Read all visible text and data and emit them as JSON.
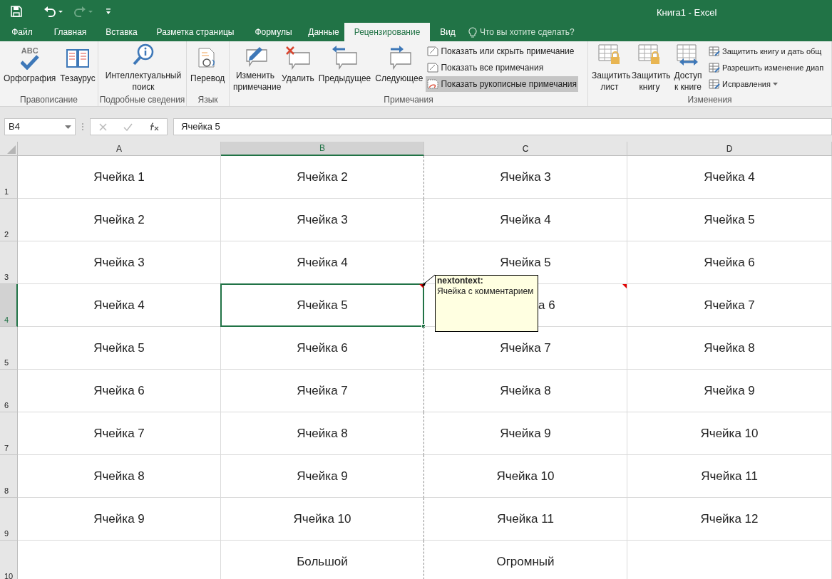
{
  "window": {
    "title": "Книга1 - Excel"
  },
  "tabs": [
    {
      "label": "Файл",
      "selected": false
    },
    {
      "label": "Главная",
      "selected": false
    },
    {
      "label": "Вставка",
      "selected": false
    },
    {
      "label": "Разметка страницы",
      "selected": false
    },
    {
      "label": "Формулы",
      "selected": false
    },
    {
      "label": "Данные",
      "selected": false
    },
    {
      "label": "Рецензирование",
      "selected": true
    },
    {
      "label": "Вид",
      "selected": false
    }
  ],
  "tell_me": {
    "placeholder": "Что вы хотите сделать?"
  },
  "ribbon_groups": [
    {
      "label": "Правописание",
      "items": [
        {
          "kind": "big",
          "label": "Орфография",
          "icon_text": "ABC",
          "on": false
        },
        {
          "kind": "big",
          "label": "Тезаурус",
          "on": false
        }
      ]
    },
    {
      "label": "Подробные сведения",
      "items": [
        {
          "kind": "big",
          "label": "Интеллектуальный поиск",
          "on": false
        }
      ]
    },
    {
      "label": "Язык",
      "items": [
        {
          "kind": "big",
          "label": "Перевод",
          "on": false
        }
      ]
    },
    {
      "label": "Примечания",
      "items": [
        {
          "kind": "big",
          "label": "Изменить примечание",
          "on": false
        },
        {
          "kind": "big",
          "label": "Удалить",
          "on": false
        },
        {
          "kind": "big",
          "label": "Предыдущее",
          "on": false
        },
        {
          "kind": "big",
          "label": "Следующее",
          "on": false
        },
        {
          "kind": "small",
          "label": "Показать или скрыть примечание",
          "on": false
        },
        {
          "kind": "small",
          "label": "Показать все примечания",
          "on": false
        },
        {
          "kind": "small",
          "label": "Показать рукописные примечания",
          "on": true
        }
      ]
    },
    {
      "label": "Изменения",
      "items": [
        {
          "kind": "big",
          "label": "Защитить лист",
          "on": false
        },
        {
          "kind": "big",
          "label": "Защитить книгу",
          "on": false
        },
        {
          "kind": "big",
          "label": "Доступ к книге",
          "on": false
        },
        {
          "kind": "small",
          "label": "Защитить книгу и дать общ",
          "on": false
        },
        {
          "kind": "small",
          "label": "Разрешить изменение диап",
          "on": false
        },
        {
          "kind": "menu",
          "label": "Исправления",
          "on": false
        }
      ]
    }
  ],
  "formula_bar": {
    "name_box": "B4",
    "value": "Ячейка 5"
  },
  "columns": [
    {
      "label": "A",
      "selected": false
    },
    {
      "label": "B",
      "selected": true
    },
    {
      "label": "C",
      "selected": false
    },
    {
      "label": "D",
      "selected": false
    }
  ],
  "rows": [
    {
      "header": "1",
      "selected": false,
      "cells": [
        {
          "text": "Ячейка 1",
          "selected": false,
          "comment": false
        },
        {
          "text": "Ячейка 2",
          "selected": false,
          "comment": false
        },
        {
          "text": "Ячейка 3",
          "selected": false,
          "comment": false
        },
        {
          "text": "Ячейка 4",
          "selected": false,
          "comment": false
        }
      ]
    },
    {
      "header": "2",
      "selected": false,
      "cells": [
        {
          "text": "Ячейка 2",
          "selected": false,
          "comment": false
        },
        {
          "text": "Ячейка 3",
          "selected": false,
          "comment": false
        },
        {
          "text": "Ячейка 4",
          "selected": false,
          "comment": false
        },
        {
          "text": "Ячейка 5",
          "selected": false,
          "comment": false
        }
      ]
    },
    {
      "header": "3",
      "selected": false,
      "cells": [
        {
          "text": "Ячейка 3",
          "selected": false,
          "comment": false
        },
        {
          "text": "Ячейка 4",
          "selected": false,
          "comment": false
        },
        {
          "text": "Ячейка 5",
          "selected": false,
          "comment": false
        },
        {
          "text": "Ячейка 6",
          "selected": false,
          "comment": false
        }
      ]
    },
    {
      "header": "4",
      "selected": true,
      "cells": [
        {
          "text": "Ячейка 4",
          "selected": false,
          "comment": false
        },
        {
          "text": "Ячейка 5",
          "selected": true,
          "comment": true
        },
        {
          "text": "а 6",
          "selected": false,
          "comment": true
        },
        {
          "text": "Ячейка 7",
          "selected": false,
          "comment": false
        }
      ]
    },
    {
      "header": "5",
      "selected": false,
      "cells": [
        {
          "text": "Ячейка 5",
          "selected": false,
          "comment": false
        },
        {
          "text": "Ячейка 6",
          "selected": false,
          "comment": false
        },
        {
          "text": "Ячейка 7",
          "selected": false,
          "comment": false
        },
        {
          "text": "Ячейка 8",
          "selected": false,
          "comment": false
        }
      ]
    },
    {
      "header": "6",
      "selected": false,
      "cells": [
        {
          "text": "Ячейка 6",
          "selected": false,
          "comment": false
        },
        {
          "text": "Ячейка 7",
          "selected": false,
          "comment": false
        },
        {
          "text": "Ячейка 8",
          "selected": false,
          "comment": false
        },
        {
          "text": "Ячейка 9",
          "selected": false,
          "comment": false
        }
      ]
    },
    {
      "header": "7",
      "selected": false,
      "cells": [
        {
          "text": "Ячейка 7",
          "selected": false,
          "comment": false
        },
        {
          "text": "Ячейка 8",
          "selected": false,
          "comment": false
        },
        {
          "text": "Ячейка 9",
          "selected": false,
          "comment": false
        },
        {
          "text": "Ячейка 10",
          "selected": false,
          "comment": false
        }
      ]
    },
    {
      "header": "8",
      "selected": false,
      "cells": [
        {
          "text": "Ячейка 8",
          "selected": false,
          "comment": false
        },
        {
          "text": "Ячейка 9",
          "selected": false,
          "comment": false
        },
        {
          "text": "Ячейка 10",
          "selected": false,
          "comment": false
        },
        {
          "text": "Ячейка 11",
          "selected": false,
          "comment": false
        }
      ]
    },
    {
      "header": "9",
      "selected": false,
      "cells": [
        {
          "text": "Ячейка 9",
          "selected": false,
          "comment": false
        },
        {
          "text": "Ячейка 10",
          "selected": false,
          "comment": false
        },
        {
          "text": "Ячейка 11",
          "selected": false,
          "comment": false
        },
        {
          "text": "Ячейка 12",
          "selected": false,
          "comment": false
        }
      ]
    },
    {
      "header": "10",
      "selected": false,
      "cells": [
        {
          "selected": false,
          "comment": false
        },
        {
          "text": "Большой",
          "selected": false,
          "comment": false
        },
        {
          "text": "Огромный",
          "selected": false,
          "comment": false
        },
        {
          "selected": false,
          "comment": false
        }
      ]
    }
  ],
  "comment": {
    "author": "nextontext:",
    "text": "Ячейка с комментарием"
  }
}
